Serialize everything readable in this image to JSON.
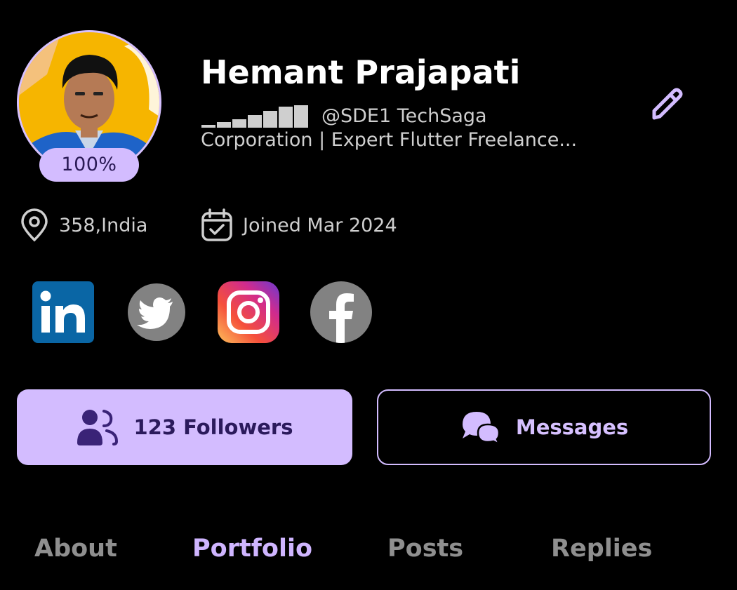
{
  "profile": {
    "name": "Hemant Prajapati",
    "completion_badge": "100%",
    "handle": "@SDE1 TechSaga",
    "bio": "Corporation | Expert Flutter Freelance...",
    "location": "358,India",
    "joined": "Joined Mar 2024"
  },
  "socials": [
    "linkedin-icon",
    "twitter-icon",
    "instagram-icon",
    "facebook-icon"
  ],
  "actions": {
    "followers_label": "123 Followers",
    "messages_label": "Messages"
  },
  "tabs": [
    {
      "label": "About",
      "active": false
    },
    {
      "label": "Portfolio",
      "active": true
    },
    {
      "label": "Posts",
      "active": false
    },
    {
      "label": "Replies",
      "active": false
    }
  ],
  "colors": {
    "background": "#000000",
    "accent": "#d3bcff",
    "accent_dark_text": "#2b1a5c",
    "muted_text": "#cfcfcf",
    "inactive_tab": "#8f8f8f"
  }
}
